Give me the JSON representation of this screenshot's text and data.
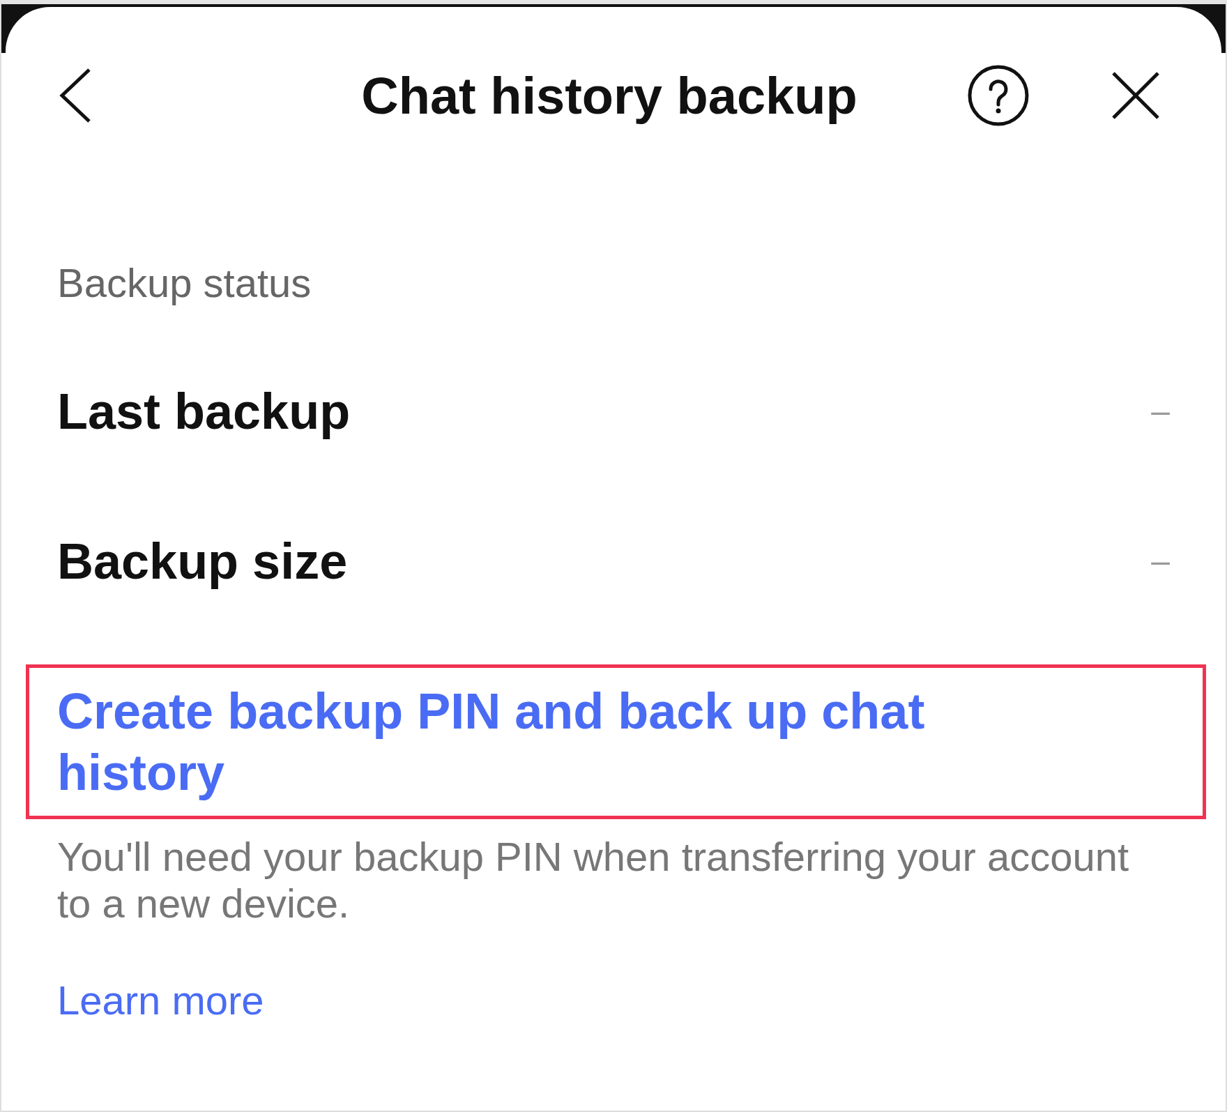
{
  "header": {
    "title": "Chat history backup"
  },
  "section": {
    "heading": "Backup status"
  },
  "rows": [
    {
      "label": "Last backup",
      "value": "–"
    },
    {
      "label": "Backup size",
      "value": "–"
    }
  ],
  "action": {
    "label": "Create backup PIN and back up chat history",
    "highlighted": true
  },
  "note": "You'll need your backup PIN when transferring your account to a new device.",
  "link": {
    "label": "Learn more"
  }
}
